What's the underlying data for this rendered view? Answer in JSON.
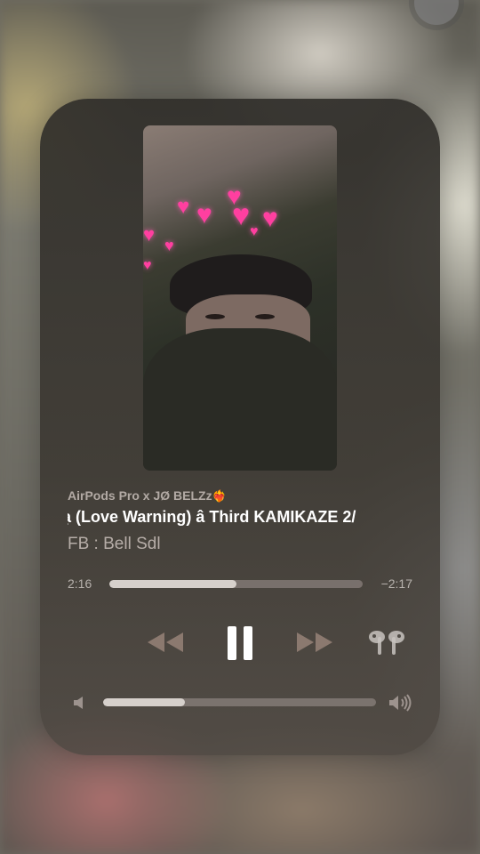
{
  "now_playing": {
    "source": "AirPods Pro x JØ BELZz",
    "source_emoji": "❤️‍🔥",
    "title": "ạ (Love Warning) â Third KAMIKAZE 2/",
    "artist": "FB : Bell Sdl",
    "elapsed": "2:16",
    "remaining": "−2:17",
    "progress_fraction": 0.5,
    "volume_fraction": 0.3
  },
  "controls": {
    "rewind_icon": "rewind-icon",
    "pause_icon": "pause-icon",
    "forward_icon": "fast-forward-icon",
    "airpods_icon": "airpods-icon",
    "volume_low_icon": "speaker-low-icon",
    "volume_high_icon": "speaker-high-icon"
  }
}
